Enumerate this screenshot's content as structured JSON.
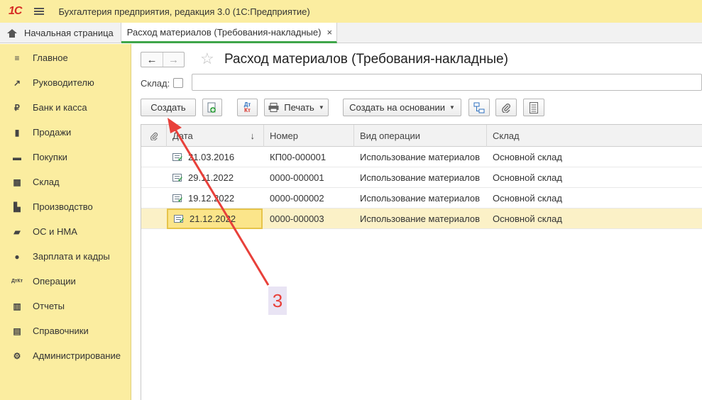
{
  "titlebar": {
    "logo": "1С",
    "menu_icon": "hamburger-icon",
    "title": "Бухгалтерия предприятия, редакция 3.0  (1С:Предприятие)"
  },
  "tabs": {
    "home_label": "Начальная страница",
    "active_label": "Расход материалов (Требования-накладные)",
    "close_glyph": "×"
  },
  "sidebar": {
    "items": [
      {
        "label": "Главное",
        "icon": "menu-list-icon",
        "glyph": "≡"
      },
      {
        "label": "Руководителю",
        "icon": "trend-icon",
        "glyph": "↗"
      },
      {
        "label": "Банк и касса",
        "icon": "coin-icon",
        "glyph": "₽"
      },
      {
        "label": "Продажи",
        "icon": "bag-icon",
        "glyph": "▮"
      },
      {
        "label": "Покупки",
        "icon": "cart-icon",
        "glyph": "▬"
      },
      {
        "label": "Склад",
        "icon": "warehouse-icon",
        "glyph": "▦"
      },
      {
        "label": "Производство",
        "icon": "factory-icon",
        "glyph": "▙"
      },
      {
        "label": "ОС и НМА",
        "icon": "truck-icon",
        "glyph": "▰"
      },
      {
        "label": "Зарплата и кадры",
        "icon": "person-icon",
        "glyph": "●"
      },
      {
        "label": "Операции",
        "icon": "dt-kt-icon",
        "glyph": "ДтКт"
      },
      {
        "label": "Отчеты",
        "icon": "bar-chart-icon",
        "glyph": "▥"
      },
      {
        "label": "Справочники",
        "icon": "book-icon",
        "glyph": "▤"
      },
      {
        "label": "Администрирование",
        "icon": "gear-icon",
        "glyph": "⚙"
      }
    ]
  },
  "header": {
    "back_glyph": "←",
    "forward_glyph": "→",
    "star_glyph": "☆",
    "title": "Расход материалов (Требования-накладные)"
  },
  "filter": {
    "sklad_label": "Склад:"
  },
  "toolbar": {
    "create_label": "Создать",
    "dtkt_top": "Дт",
    "dtkt_bottom": "Кт",
    "print_label": "Печать",
    "basis_label": "Создать на основании",
    "caret": "▼"
  },
  "table": {
    "columns": [
      "Дата",
      "Номер",
      "Вид операции",
      "Склад"
    ],
    "sort_glyph": "↓",
    "attach_glyph": "⌀",
    "rows": [
      {
        "date": "21.03.2016",
        "number": "КП00-000001",
        "operation": "Использование материалов",
        "sklad": "Основной склад"
      },
      {
        "date": "29.11.2022",
        "number": "0000-000001",
        "operation": "Использование материалов",
        "sklad": "Основной склад"
      },
      {
        "date": "19.12.2022",
        "number": "0000-000002",
        "operation": "Использование материалов",
        "sklad": "Основной склад"
      },
      {
        "date": "21.12.2022",
        "number": "0000-000003",
        "operation": "Использование материалов",
        "sklad": "Основной склад"
      }
    ]
  },
  "annotation": {
    "label": "3",
    "color": "#e8403a"
  }
}
